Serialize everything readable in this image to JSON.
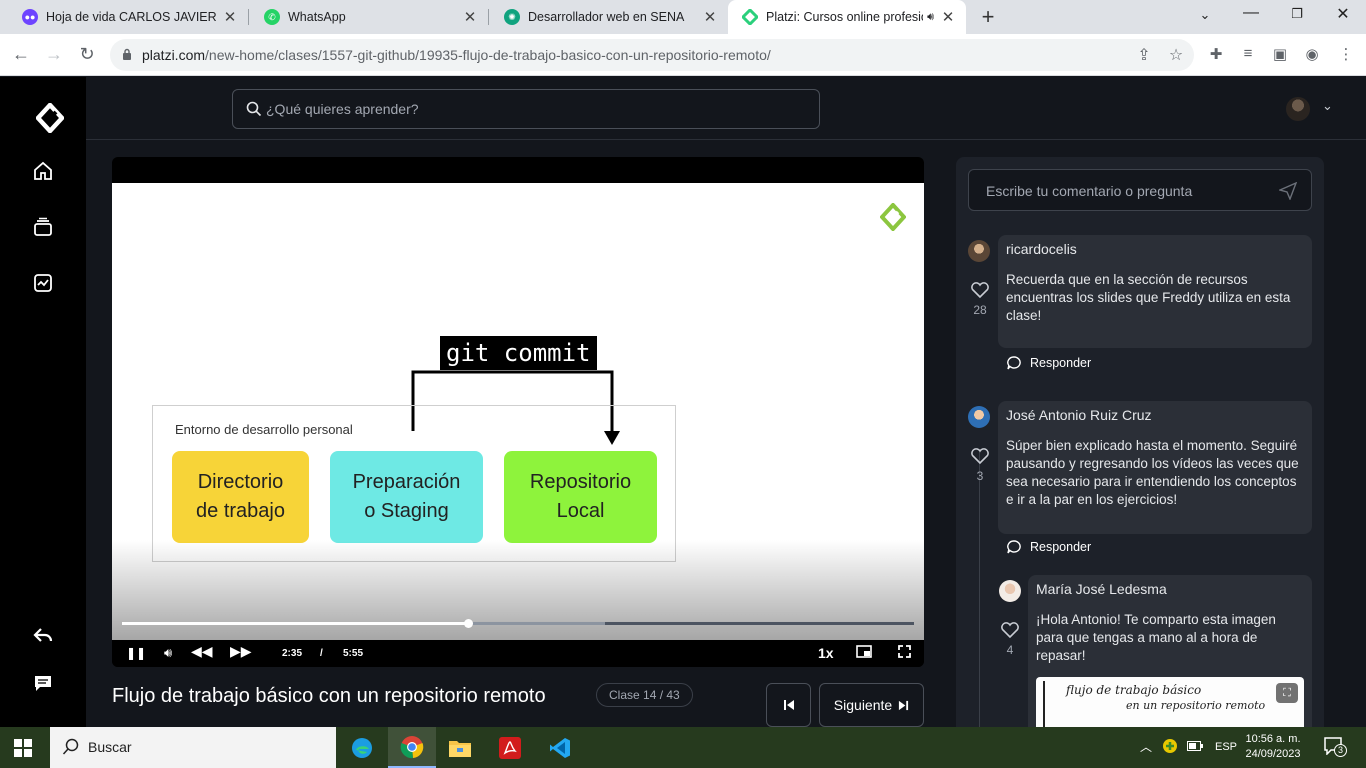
{
  "browser": {
    "tabs": [
      {
        "title": "Hoja de vida CARLOS JAVIER LO",
        "favicon": "ai-tool-icon",
        "color": "#6e44ff"
      },
      {
        "title": "WhatsApp",
        "favicon": "whatsapp-icon",
        "color": "#25d366"
      },
      {
        "title": "Desarrollador web en SENA",
        "favicon": "chatgpt-icon",
        "color": "#10a37f"
      },
      {
        "title": "Platzi: Cursos online profesio",
        "favicon": "platzi-icon",
        "color": "#98ca3f"
      }
    ],
    "url_domain": "platzi.com",
    "url_path": "/new-home/clases/1557-git-github/19935-flujo-de-trabajo-basico-con-un-repositorio-remoto/"
  },
  "header": {
    "search_placeholder": "¿Qué quieres aprender?"
  },
  "video": {
    "slide": {
      "git_label": "git commit",
      "env_label": "Entorno de desarrollo personal",
      "cards": [
        {
          "label": "Directorio de trabajo",
          "line1": "Directorio",
          "line2": "de trabajo",
          "color": "#f7d438"
        },
        {
          "label": "Preparación o Staging",
          "line1": "Preparación",
          "line2": "o Staging",
          "color": "#6ee9e4"
        },
        {
          "label": "Repositorio Local",
          "line1": "Repositorio",
          "line2": "Local",
          "color": "#8ef33c"
        }
      ]
    },
    "current_time": "2:35",
    "separator": "/",
    "duration": "5:55",
    "progress_fraction": 0.4366,
    "buffered_fraction": 0.61,
    "speed": "1x"
  },
  "lesson": {
    "title": "Flujo de trabajo básico con un repositorio remoto",
    "class_badge": "Clase 14 / 43",
    "next_label": "Siguiente"
  },
  "comments": {
    "input_placeholder": "Escribe tu comentario o pregunta",
    "reply_label": "Responder",
    "items": [
      {
        "author": "ricardocelis",
        "text": "Recuerda que en la sección de recursos encuentras los slides que Freddy utiliza en esta clase!",
        "likes": "28"
      },
      {
        "author": "José Antonio Ruiz Cruz",
        "text": "Súper bien explicado hasta el momento. Seguiré pausando y regresando los vídeos las veces que sea necesario para ir entendiendo los conceptos e ir a la par en los ejercicios!",
        "likes": "3"
      },
      {
        "author": "María José Ledesma",
        "text": "¡Hola Antonio! Te comparto esta imagen para que tengas a mano al a hora de repasar!",
        "likes": "4"
      }
    ],
    "thumb_line1": "flujo de trabajo básico",
    "thumb_line2": "en un repositorio remoto"
  },
  "taskbar": {
    "search_placeholder": "Buscar",
    "language": "ESP",
    "time": "10:56 a. m.",
    "date": "24/09/2023",
    "notifications": "3"
  }
}
